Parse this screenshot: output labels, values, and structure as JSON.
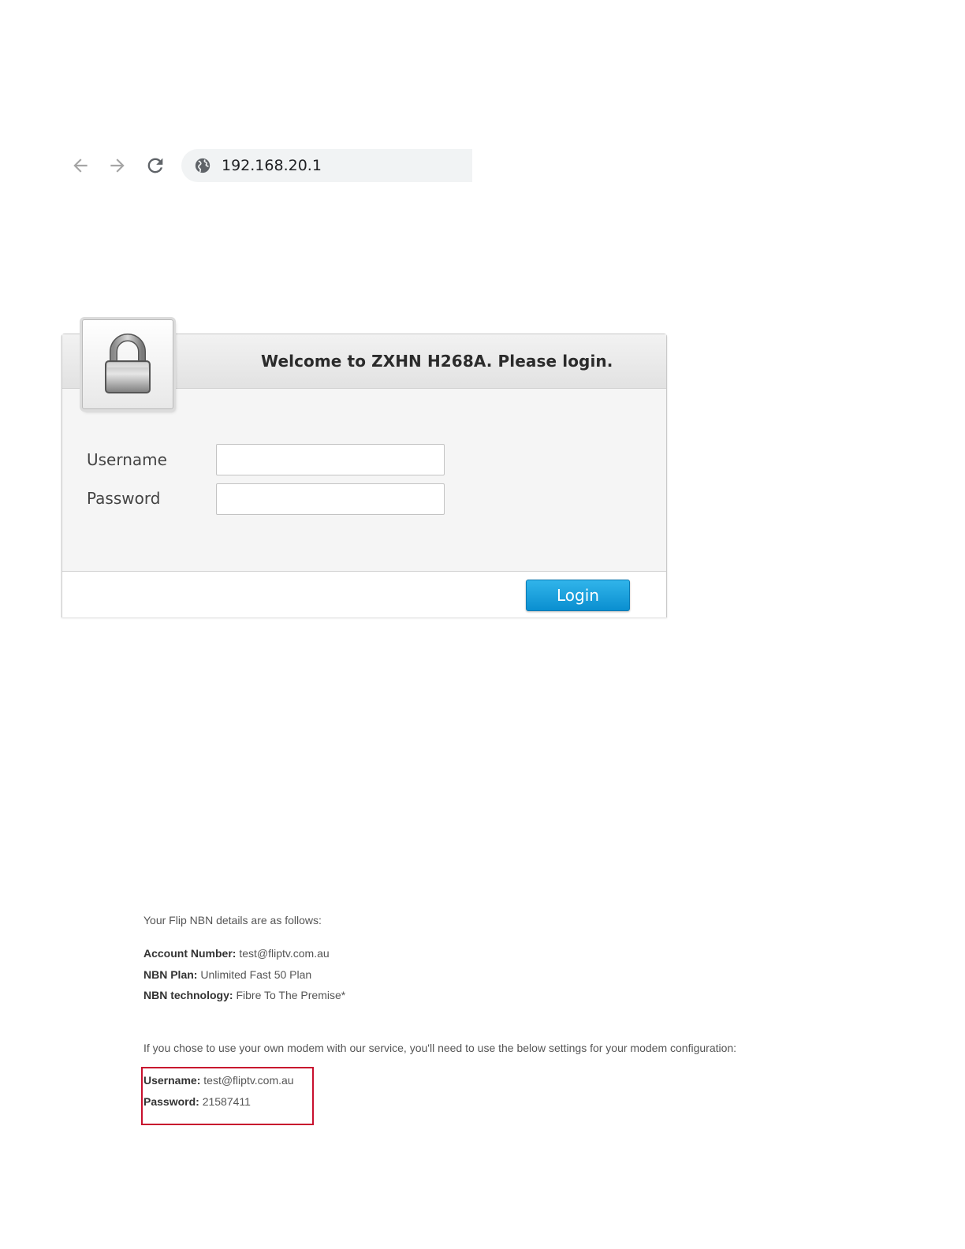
{
  "browser": {
    "url": "192.168.20.1",
    "icons": [
      "back-arrow-icon",
      "forward-arrow-icon",
      "reload-icon",
      "globe-icon"
    ]
  },
  "login_panel": {
    "title": "Welcome to ZXHN H268A. Please login.",
    "username_label": "Username",
    "password_label": "Password",
    "username_value": "",
    "password_value": "",
    "login_label": "Login",
    "icon": "padlock-icon"
  },
  "email": {
    "intro": "Your Flip NBN details are as follows:",
    "account_number_label": "Account Number:",
    "account_number_value": "test@fliptv.com.au",
    "nbn_plan_label": "NBN Plan:",
    "nbn_plan_value": "Unlimited Fast 50 Plan",
    "nbn_technology_label": "NBN technology:",
    "nbn_technology_value": "Fibre To The Premise*",
    "own_modem_text": "If you chose to use your own modem with our service, you'll need to use the below settings for your modem configuration:",
    "credentials": {
      "username_label": "Username:",
      "username_value": "test@fliptv.com.au",
      "password_label": "Password:",
      "password_value": "21587411"
    }
  },
  "colors": {
    "login_button": "#0a8fd0",
    "highlight_border": "#c8102e",
    "address_bar": "#f1f3f4"
  }
}
